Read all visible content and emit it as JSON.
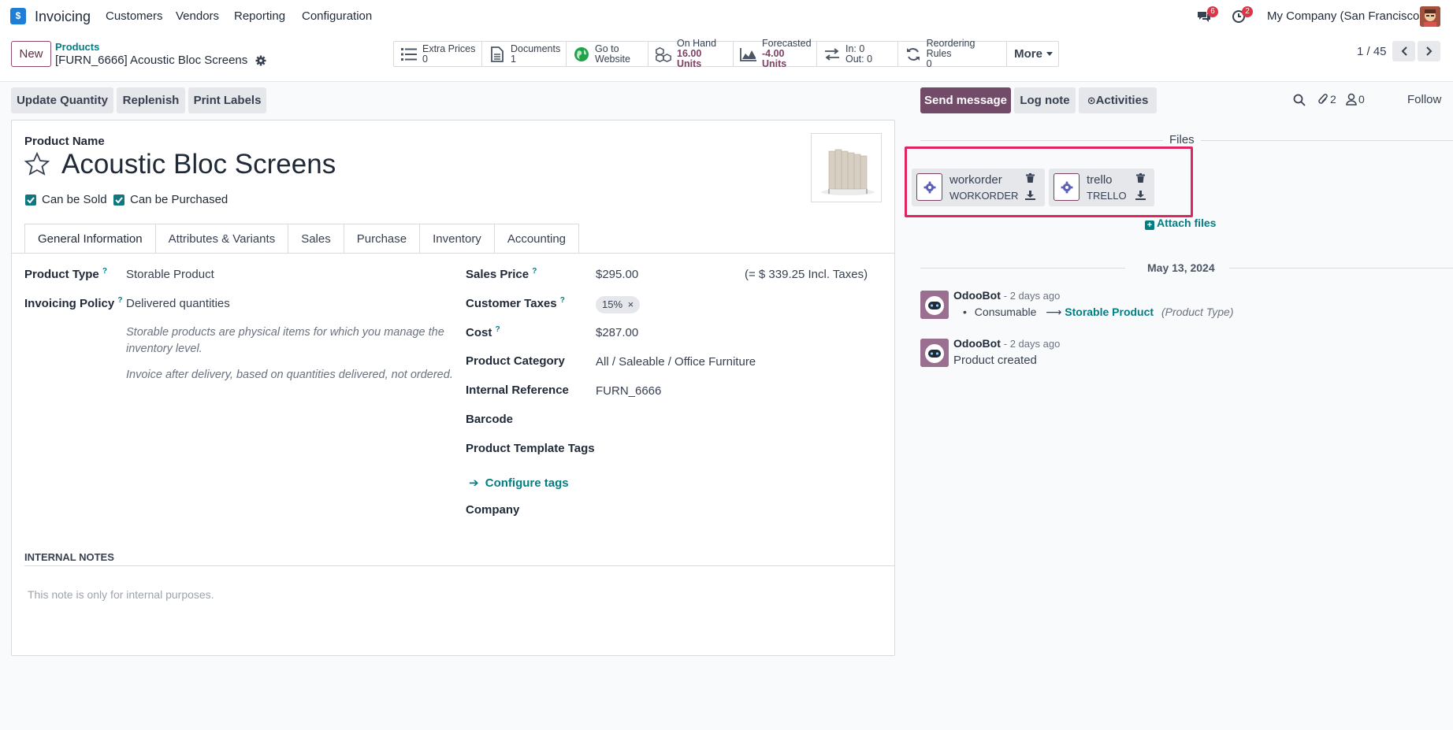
{
  "navbar": {
    "app_name": "Invoicing",
    "menu": [
      "Customers",
      "Vendors",
      "Reporting",
      "Configuration"
    ],
    "messages_badge": "6",
    "activities_badge": "2",
    "company": "My Company (San Francisco)"
  },
  "control_panel": {
    "new_label": "New",
    "breadcrumb_parent": "Products",
    "breadcrumb_current": "[FURN_6666] Acoustic Bloc Screens",
    "smart_buttons": [
      {
        "line1": "Extra Prices",
        "line2": "0",
        "icon": "list-icon"
      },
      {
        "line1": "Documents",
        "line2": "1",
        "icon": "file-icon"
      },
      {
        "line1": "Go to",
        "line2": "Website",
        "icon": "globe-icon"
      },
      {
        "line1": "On Hand",
        "line2": "16.00 Units",
        "icon": "cubes-icon"
      },
      {
        "line1": "Forecasted",
        "line2": "-4.00 Units",
        "icon": "area-chart-icon"
      },
      {
        "line1": "In: 0",
        "line2": "Out: 0",
        "icon": "exchange-icon"
      },
      {
        "line1": "Reordering Rules",
        "line2": "0",
        "icon": "refresh-icon"
      }
    ],
    "more_label": "More",
    "pager": "1 / 45"
  },
  "actions": [
    "Update Quantity",
    "Replenish",
    "Print Labels"
  ],
  "form": {
    "product_name_label": "Product Name",
    "product_name": "Acoustic Bloc Screens",
    "can_be_sold": "Can be Sold",
    "can_be_purchased": "Can be Purchased",
    "tabs": [
      "General Information",
      "Attributes & Variants",
      "Sales",
      "Purchase",
      "Inventory",
      "Accounting"
    ],
    "product_type_label": "Product Type",
    "product_type": "Storable Product",
    "invoicing_policy_label": "Invoicing Policy",
    "invoicing_policy": "Delivered quantities",
    "help_storable": "Storable products are physical items for which you manage the inventory level.",
    "help_invoice": "Invoice after delivery, based on quantities delivered, not ordered.",
    "sales_price_label": "Sales Price",
    "sales_price": "$295.00",
    "incl_taxes": "(= $ 339.25 Incl. Taxes)",
    "customer_taxes_label": "Customer Taxes",
    "customer_tax_tag": "15%",
    "cost_label": "Cost",
    "cost": "$287.00",
    "category_label": "Product Category",
    "category": "All / Saleable / Office Furniture",
    "internal_ref_label": "Internal Reference",
    "internal_ref": "FURN_6666",
    "barcode_label": "Barcode",
    "template_tags_label": "Product Template Tags",
    "configure_tags": "Configure tags",
    "company_label": "Company",
    "internal_notes_label": "INTERNAL NOTES",
    "internal_notes_placeholder": "This note is only for internal purposes."
  },
  "chatter": {
    "send_message": "Send message",
    "log_note": "Log note",
    "activities": "Activities",
    "attachments_count": "2",
    "followers_count": "0",
    "follow": "Follow",
    "files_label": "Files",
    "files": [
      {
        "name": "workorder",
        "ext": "WORKORDER"
      },
      {
        "name": "trello",
        "ext": "TRELLO"
      }
    ],
    "attach_files": "Attach files",
    "date": "May 13, 2024",
    "messages": [
      {
        "author": "OdooBot",
        "time": "- 2 days ago",
        "old": "Consumable",
        "new": "Storable Product",
        "field": "(Product Type)"
      },
      {
        "author": "OdooBot",
        "time": "- 2 days ago",
        "body": "Product created"
      }
    ]
  },
  "colors": {
    "brand": "#714B67",
    "teal": "#017e84",
    "highlight": "#e0245e"
  }
}
